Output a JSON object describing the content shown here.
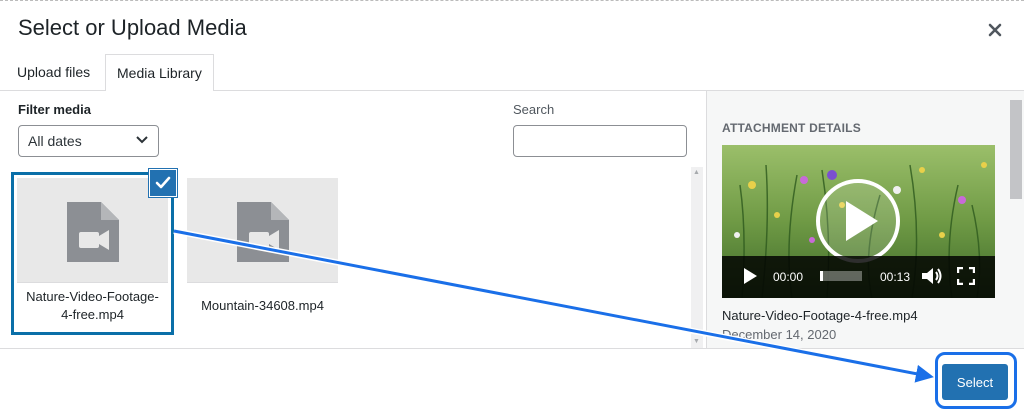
{
  "modal": {
    "title": "Select or Upload Media",
    "close_icon": "close-icon"
  },
  "tabs": [
    {
      "label": "Upload files",
      "active": false
    },
    {
      "label": "Media Library",
      "active": true
    }
  ],
  "filter": {
    "label": "Filter media",
    "date_value": "All dates"
  },
  "search": {
    "label": "Search",
    "value": ""
  },
  "media_items": [
    {
      "filename": "Nature-Video-Footage-4-free.mp4",
      "selected": true,
      "icon": "video-file-icon"
    },
    {
      "filename": "Mountain-34608.mp4",
      "selected": false,
      "icon": "video-file-icon"
    }
  ],
  "attachment": {
    "heading": "ATTACHMENT DETAILS",
    "current_time": "00:00",
    "duration": "00:13",
    "progress": 0.05,
    "filename": "Nature-Video-Footage-4-free.mp4",
    "date": "December 14, 2020"
  },
  "toolbar": {
    "select_label": "Select"
  },
  "colors": {
    "accent": "#2271b1",
    "selection_border": "#0a6fa8",
    "annotation": "#1a6fe8"
  }
}
